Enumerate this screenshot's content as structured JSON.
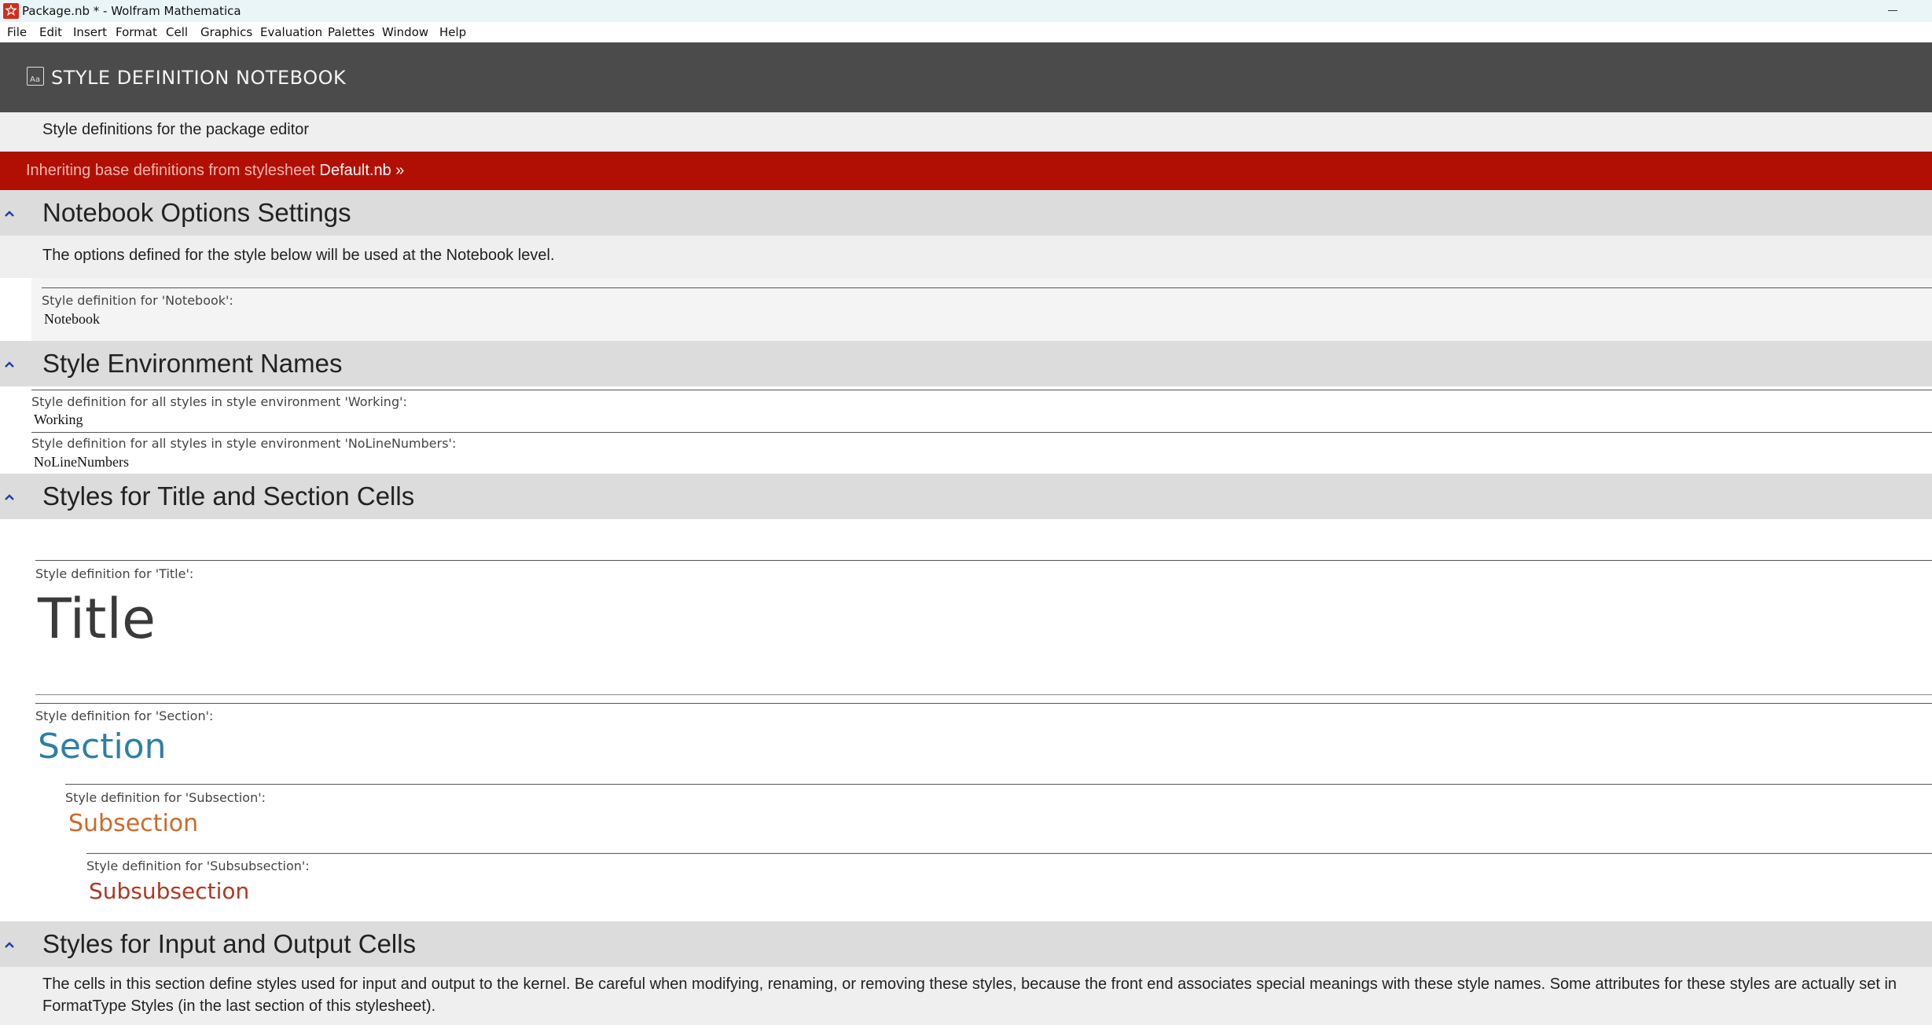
{
  "window": {
    "title": "Package.nb * - Wolfram Mathematica"
  },
  "menu": [
    "File",
    "Edit",
    "Insert",
    "Format",
    "Cell",
    "Graphics",
    "Evaluation",
    "Palettes",
    "Window",
    "Help"
  ],
  "header": {
    "icon_text": "Aa",
    "title": "STYLE DEFINITION NOTEBOOK",
    "subtitle": "Style definitions for the package editor",
    "inherit_prefix": "Inheriting base definitions from stylesheet",
    "inherit_link": "Default.nb »"
  },
  "sections": {
    "notebook_options": {
      "title": "Notebook Options Settings",
      "description": "The options defined for the style below will be used at the Notebook level.",
      "def_label": "Style definition for 'Notebook':",
      "def_value": "Notebook"
    },
    "environments": {
      "title": "Style Environment Names",
      "items": [
        {
          "label": "Style definition for all styles in style environment 'Working':",
          "value": "Working"
        },
        {
          "label": "Style definition for all styles in style environment 'NoLineNumbers':",
          "value": "NoLineNumbers"
        }
      ]
    },
    "title_section": {
      "title": "Styles for Title and Section Cells",
      "title_label": "Style definition for 'Title':",
      "title_value": "Title",
      "section_label": "Style definition for 'Section':",
      "section_value": "Section",
      "subsection_label": "Style definition for 'Subsection':",
      "subsection_value": "Subsection",
      "subsubsection_label": "Style definition for 'Subsubsection':",
      "subsubsection_value": "Subsubsection"
    },
    "io_section": {
      "title": "Styles for Input and Output Cells",
      "description_line1": "The cells in this section define styles used for input and output to the kernel.  Be careful when modifying, renaming, or removing these styles, because the front end associates special meanings with these style names. Some attributes for these styles are actually set in",
      "description_line2": "FormatType Styles (in the last section of this stylesheet)."
    }
  },
  "colors": {
    "header_bg": "#4b4b4b",
    "inherit_bar": "#b20f04",
    "section_row": "#dcdcdc",
    "section_style": "#2e7fa5",
    "subsection_style": "#cc6a2a",
    "subsubsection_style": "#b13821"
  }
}
